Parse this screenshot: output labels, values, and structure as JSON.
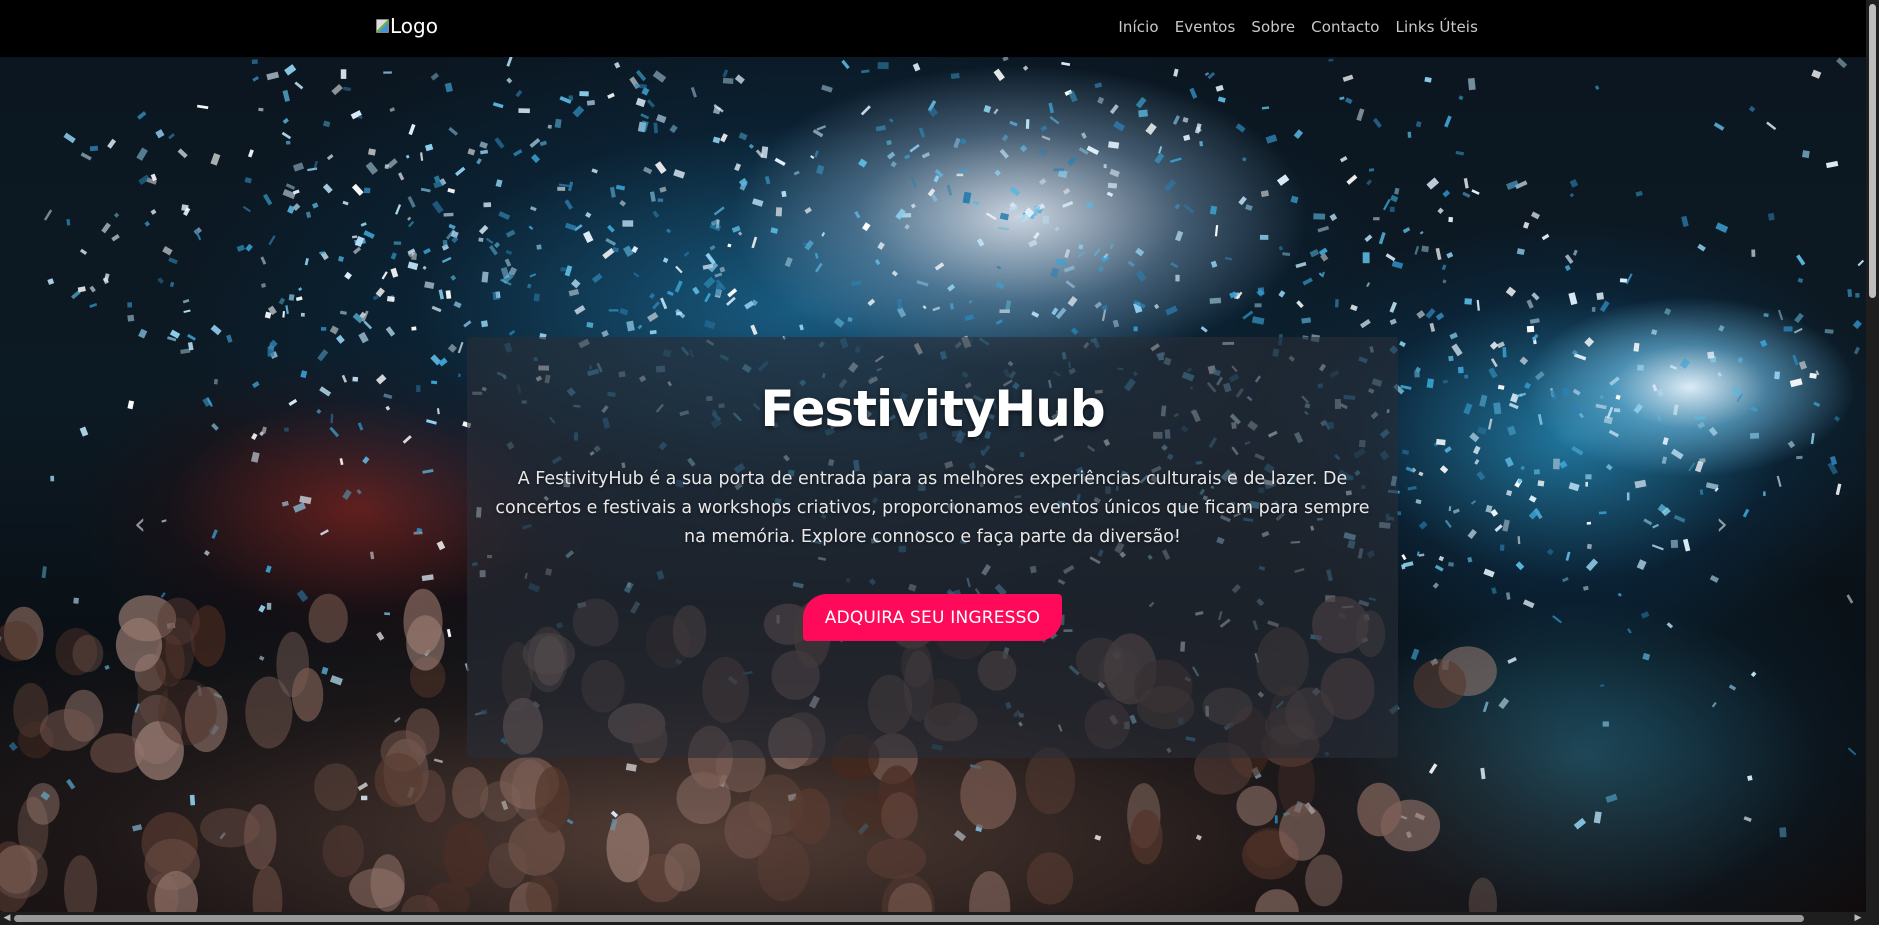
{
  "navbar": {
    "logo_alt": "Logo",
    "links": [
      "Início",
      "Eventos",
      "Sobre",
      "Contacto",
      "Links Úteis"
    ]
  },
  "hero": {
    "title": "FestivityHub",
    "description": "A FestivityHub é a sua porta de entrada para as melhores experiências culturais e de lazer. De concertos e festivais a workshops criativos, proporcionamos eventos únicos que ficam para sempre na memória. Explore connosco e faça parte da diversão!",
    "cta_label": "ADQUIRA SEU INGRESSO",
    "prev_icon": "chevron-left-icon",
    "next_icon": "chevron-right-icon"
  },
  "colors": {
    "navbar_bg": "#000000",
    "cta_bg": "#ff0a5a",
    "overlay_bg": "rgba(40,45,55,0.62)"
  }
}
